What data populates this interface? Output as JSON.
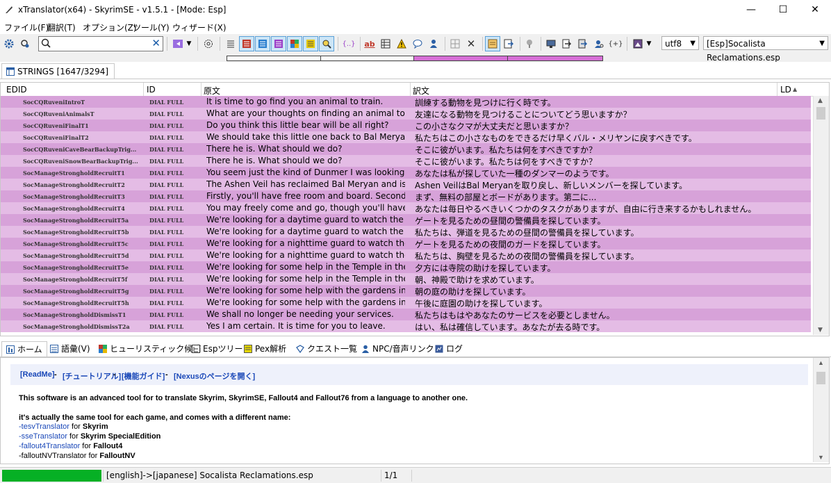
{
  "window": {
    "title": "xTranslator(x64) - SkyrimSE - v1.5.1 - [Mode: Esp]",
    "minimize": "—",
    "maximize": "☐",
    "close": "✕"
  },
  "menu": [
    "ファイル(F)",
    "翻訳(T)",
    "オプション(Z)",
    "ツール(Y)",
    "ウィザード(X)"
  ],
  "toolbar": {
    "search_value": "",
    "search_clear": "✕",
    "braces": "{..}",
    "paren_plus": "{+}",
    "encoding": "utf8",
    "file": "[Esp]Socalista Reclamations.esp"
  },
  "tab": {
    "label": "STRINGS [1647/3294]"
  },
  "grid": {
    "headers": {
      "edid": "EDID",
      "id": "ID",
      "source": "原文",
      "dest": "訳文",
      "ld": "LD"
    },
    "rows": [
      {
        "edid": "SocCQRuveniIntroT",
        "id": "DIAL FULL",
        "source": "It is time to go find you an animal to train.",
        "dest": "訓練する動物を見つけに行く時です。"
      },
      {
        "edid": "SocCQRuveniAnimalsT",
        "id": "DIAL FULL",
        "source": "What are your thoughts on finding an animal to befriend?",
        "dest": "友達になる動物を見つけることについてどう思いますか？"
      },
      {
        "edid": "SocCQRuveniFinalT1",
        "id": "DIAL FULL",
        "source": "Do you think this little bear will be all right?",
        "dest": "この小さなクマが大丈夫だと思いますか？"
      },
      {
        "edid": "SocCQRuveniFinalT2",
        "id": "DIAL FULL",
        "source": "We should take this little one back to Bal Meryan as soo...",
        "dest": "私たちはこの小さなものをできるだけ早くバル・メリヤンに戻すべきです。"
      },
      {
        "edid": "SocCQRuveniCaveBearBackupTrig...",
        "id": "DIAL FULL",
        "source": "There he is. What should we do?",
        "dest": "そこに彼がいます。私たちは何をすべきですか？"
      },
      {
        "edid": "SocCQRuveniSnowBearBackupTrig...",
        "id": "DIAL FULL",
        "source": "There he is. What should we do?",
        "dest": "そこに彼がいます。私たちは何をすべきですか？"
      },
      {
        "edid": "SocManageStrongholdRecruitT1",
        "id": "DIAL FULL",
        "source": "You seem just the kind of Dunmer I was looking for.",
        "dest": "あなたは私が探していた一種のダンマーのようです。"
      },
      {
        "edid": "SocManageStrongholdRecruitT2",
        "id": "DIAL FULL",
        "source": "The Ashen Veil has reclaimed Bal Meryan and is looking f...",
        "dest": "Ashen VeilはBal Meryanを取り戻し、新しいメンバーを探しています。"
      },
      {
        "edid": "SocManageStrongholdRecruitT3",
        "id": "DIAL FULL",
        "source": "Firstly, you'll have free room and board. Secondly....",
        "dest": "まず、無料の部屋とボードがあります。第二に..."
      },
      {
        "edid": "SocManageStrongholdRecruitT4",
        "id": "DIAL FULL",
        "source": "You may freely come and go, though you'll have some d...",
        "dest": "あなたは毎日やるべきいくつかのタスクがありますが、自由に行き来するかもしれません。"
      },
      {
        "edid": "SocManageStrongholdRecruitT5a",
        "id": "DIAL FULL",
        "source": "We're looking for a daytime guard to watch the gate.",
        "dest": "ゲートを見るための昼間の警備員を探しています。"
      },
      {
        "edid": "SocManageStrongholdRecruitT5b",
        "id": "DIAL FULL",
        "source": "We're looking for a daytime guard to watch the battlem...",
        "dest": "私たちは、弾道を見るための昼間の警備員を探しています。"
      },
      {
        "edid": "SocManageStrongholdRecruitT5c",
        "id": "DIAL FULL",
        "source": "We're looking for a nighttime guard to watch the gate.",
        "dest": "ゲートを見るための夜間のガードを探しています。"
      },
      {
        "edid": "SocManageStrongholdRecruitT5d",
        "id": "DIAL FULL",
        "source": "We're looking for a nighttime guard to watch the battle...",
        "dest": "私たちは、胸壁を見るための夜間の警備員を探しています。"
      },
      {
        "edid": "SocManageStrongholdRecruitT5e",
        "id": "DIAL FULL",
        "source": "We're looking for some help in the Temple in the evening.",
        "dest": "夕方には寺院の助けを探しています。"
      },
      {
        "edid": "SocManageStrongholdRecruitT5f",
        "id": "DIAL FULL",
        "source": "We're looking for some help in the Temple in the morning.",
        "dest": "朝、神殿で助けを求めています。"
      },
      {
        "edid": "SocManageStrongholdRecruitT5g",
        "id": "DIAL FULL",
        "source": "We're looking for some help with the gardens in the mor...",
        "dest": "朝の庭の助けを探しています。"
      },
      {
        "edid": "SocManageStrongholdRecruitT5h",
        "id": "DIAL FULL",
        "source": "We're looking for some help with the gardens in the afte...",
        "dest": "午後に庭園の助けを探しています。"
      },
      {
        "edid": "SocManageStrongholdDismissT1",
        "id": "DIAL FULL",
        "source": "We shall no longer be needing your services.",
        "dest": "私たちはもはやあなたのサービスを必要としません。"
      },
      {
        "edid": "SocManageStrongholdDismissT2a",
        "id": "DIAL FULL",
        "source": "Yes I am certain. It is time for you to leave.",
        "dest": "はい、私は確信しています。あなたが去る時です。"
      }
    ]
  },
  "bottom_tabs": [
    "ホーム",
    "語彙(V)",
    "ヒューリスティック候補",
    "Espツリー",
    "Pex解析",
    "クエスト一覧",
    "NPC/音声リンク",
    "ログ"
  ],
  "info": {
    "link_readme": "[ReadMe]",
    "link_tutorial": "[チュートリアル]",
    "link_guide": "[機能ガイド]",
    "link_nexus": "[Nexusのページを開く]",
    "sep": " - ",
    "p1": "This software is an advanced tool for to translate Skyrim, SkyrimSE, Fallout4 and Fallout76 from a language to another one.",
    "p2": "it's actually the same tool for each game, and comes with a different name:",
    "items": [
      {
        "link": "-tesvTranslator",
        "for": " for ",
        "game": "Skyrim"
      },
      {
        "link": "-sseTranslator",
        "for": " for ",
        "game": "Skyrim SpecialEdition"
      },
      {
        "link": "-fallout4Translator",
        "for": " for ",
        "game": "Fallout4"
      },
      {
        "link": "-falloutNVTranslator",
        "for": " for ",
        "game": "FalloutNV"
      }
    ]
  },
  "status": {
    "lang": "[english]->[japanese] Socalista Reclamations.esp",
    "page": "1/1"
  },
  "colors": {
    "row_dark": "#d7a2d9",
    "row_light": "#e4bce5",
    "progress_green": "#06b025",
    "toolbar_pink": "#d56fd5"
  }
}
